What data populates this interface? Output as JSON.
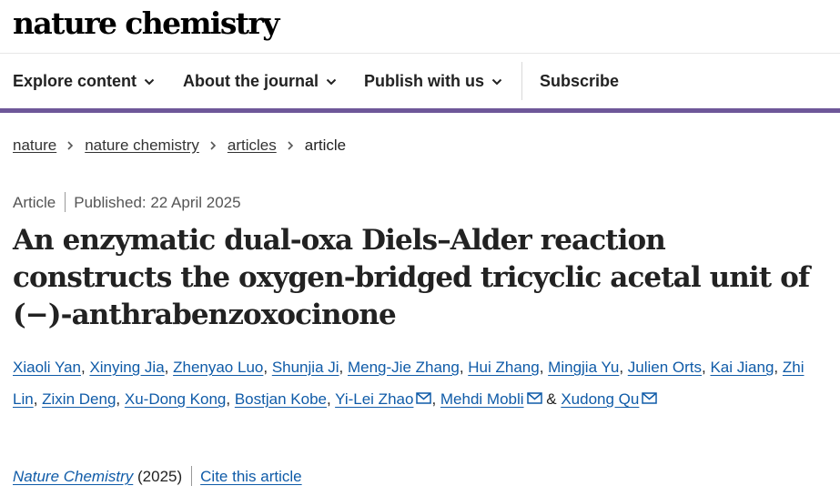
{
  "header": {
    "logo_text": "nature chemistry"
  },
  "nav": {
    "explore_label": "Explore content",
    "about_label": "About the journal",
    "publish_label": "Publish with us",
    "subscribe_label": "Subscribe",
    "accent_color": "#6e5799"
  },
  "breadcrumb": [
    "nature",
    "nature chemistry",
    "articles",
    "article"
  ],
  "article": {
    "type": "Article",
    "published": "Published: 22 April 2025",
    "title": "An enzymatic dual-oxa Diels–Alder reaction constructs the oxygen-bridged tricyclic acetal unit of (−)-anthrabenzoxocinone",
    "authors": [
      "Xiaoli Yan",
      "Xinying Jia",
      "Zhenyao Luo",
      "Shunjia Ji",
      "Meng-Jie Zhang",
      "Hui Zhang",
      "Mingjia Yu",
      "Julien Orts",
      "Kai Jiang",
      "Zhi Lin",
      "Zixin Deng",
      "Xu-Dong Kong",
      "Bostjan Kobe",
      "Yi-Lei Zhao",
      "Mehdi Mobli",
      "Xudong Qu"
    ],
    "author_separator": ", ",
    "author_conjunction": " & ",
    "corresponding_icon": "mail-icon",
    "journal": "Nature Chemistry",
    "year": "(2025)",
    "cite_label": "Cite this article",
    "link_color": "#0f5ba8"
  }
}
